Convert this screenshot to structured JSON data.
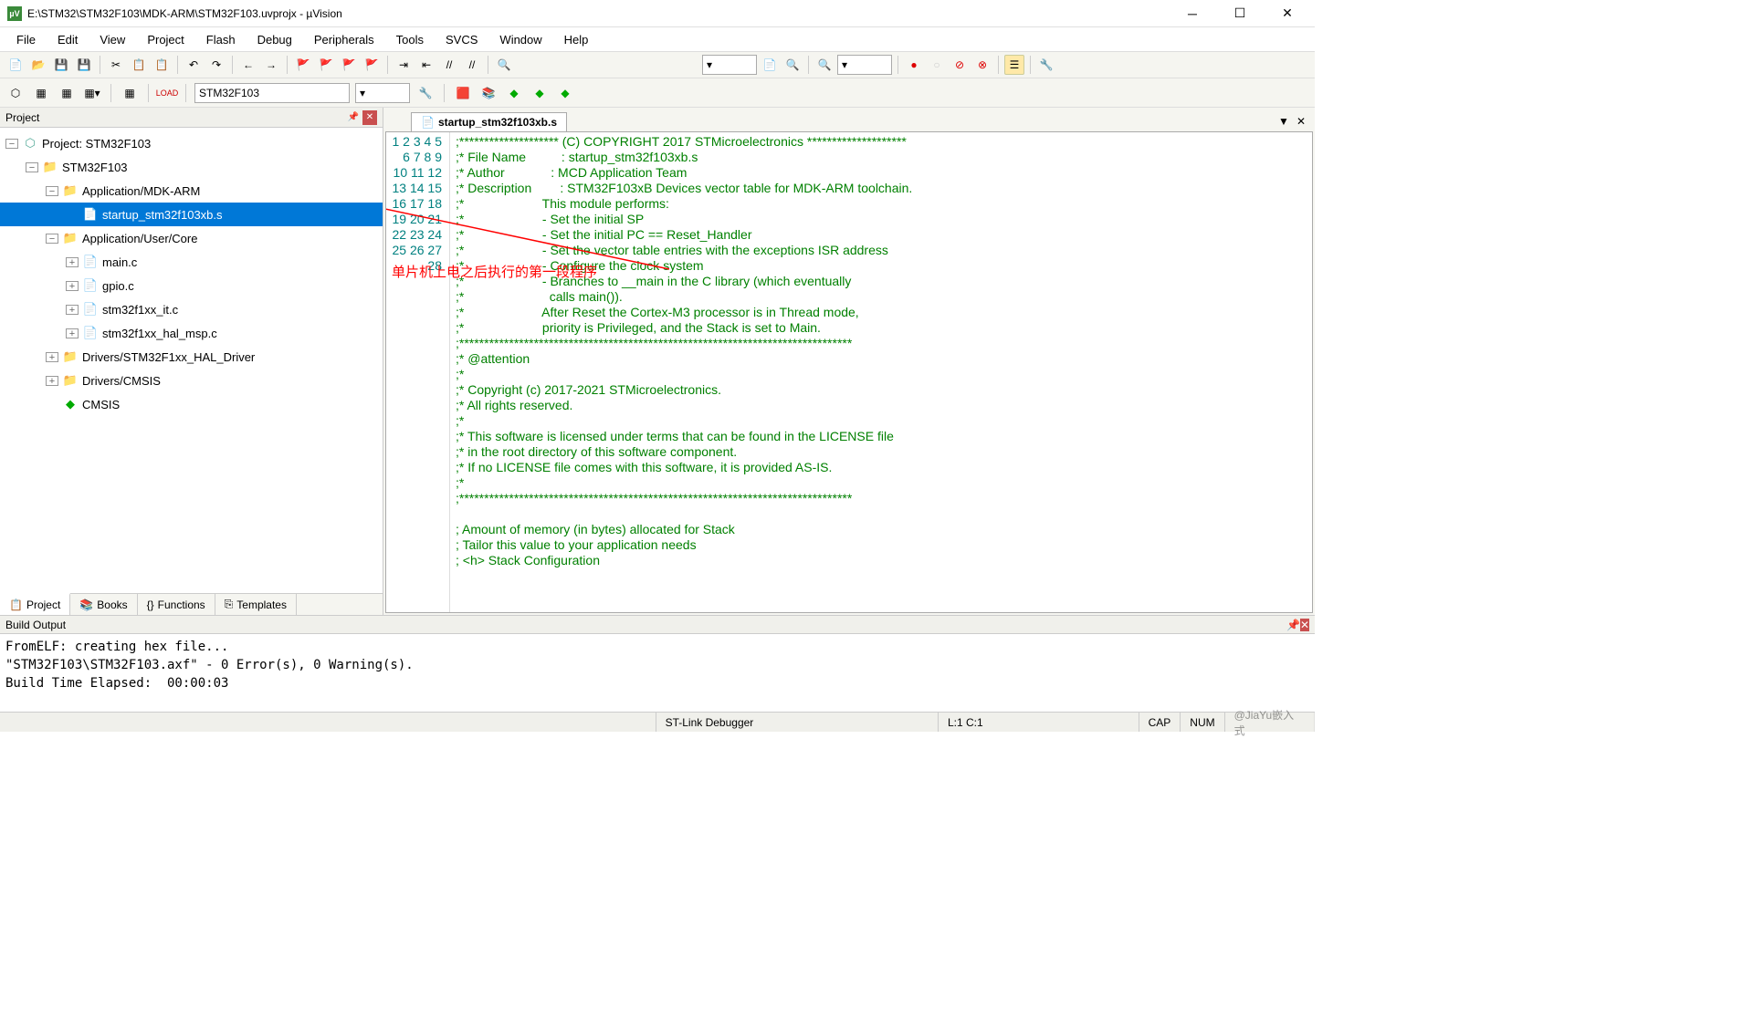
{
  "window": {
    "title": "E:\\STM32\\STM32F103\\MDK-ARM\\STM32F103.uvprojx - µVision"
  },
  "menu": [
    "File",
    "Edit",
    "View",
    "Project",
    "Flash",
    "Debug",
    "Peripherals",
    "Tools",
    "SVCS",
    "Window",
    "Help"
  ],
  "toolbar2": {
    "target": "STM32F103"
  },
  "project_panel": {
    "title": "Project",
    "root": "Project: STM32F103",
    "target": "STM32F103",
    "groups": [
      {
        "label": "Application/MDK-ARM",
        "expanded": true,
        "files": [
          {
            "label": "startup_stm32f103xb.s",
            "selected": true
          }
        ]
      },
      {
        "label": "Application/User/Core",
        "expanded": true,
        "files": [
          {
            "label": "main.c"
          },
          {
            "label": "gpio.c"
          },
          {
            "label": "stm32f1xx_it.c"
          },
          {
            "label": "stm32f1xx_hal_msp.c"
          }
        ]
      },
      {
        "label": "Drivers/STM32F1xx_HAL_Driver",
        "expanded": false
      },
      {
        "label": "Drivers/CMSIS",
        "expanded": false
      },
      {
        "label": "CMSIS",
        "icon": "diamond"
      }
    ],
    "tabs": [
      "Project",
      "Books",
      "Functions",
      "Templates"
    ]
  },
  "editor": {
    "tab": "startup_stm32f103xb.s",
    "lines": [
      ";******************** (C) COPYRIGHT 2017 STMicroelectronics ********************",
      ";* File Name          : startup_stm32f103xb.s",
      ";* Author             : MCD Application Team",
      ";* Description        : STM32F103xB Devices vector table for MDK-ARM toolchain.",
      ";*                      This module performs:",
      ";*                      - Set the initial SP",
      ";*                      - Set the initial PC == Reset_Handler",
      ";*                      - Set the vector table entries with the exceptions ISR address",
      ";*                      - Configure the clock system",
      ";*                      - Branches to __main in the C library (which eventually",
      ";*                        calls main()).",
      ";*                      After Reset the Cortex-M3 processor is in Thread mode,",
      ";*                      priority is Privileged, and the Stack is set to Main.",
      ";*******************************************************************************",
      ";* @attention",
      ";*",
      ";* Copyright (c) 2017-2021 STMicroelectronics.",
      ";* All rights reserved.",
      ";*",
      ";* This software is licensed under terms that can be found in the LICENSE file",
      ";* in the root directory of this software component.",
      ";* If no LICENSE file comes with this software, it is provided AS-IS.",
      ";*",
      ";*******************************************************************************",
      "",
      "; Amount of memory (in bytes) allocated for Stack",
      "; Tailor this value to your application needs",
      "; <h> Stack Configuration"
    ],
    "annotation": "单片机上电之后执行的第一段程序"
  },
  "build": {
    "title": "Build Output",
    "lines": [
      "FromELF: creating hex file...",
      "\"STM32F103\\STM32F103.axf\" - 0 Error(s), 0 Warning(s).",
      "Build Time Elapsed:  00:00:03"
    ]
  },
  "status": {
    "debugger": "ST-Link Debugger",
    "cursor": "L:1 C:1",
    "cap": "CAP",
    "num": "NUM",
    "watermark": "@JiaYu嵌入式"
  }
}
